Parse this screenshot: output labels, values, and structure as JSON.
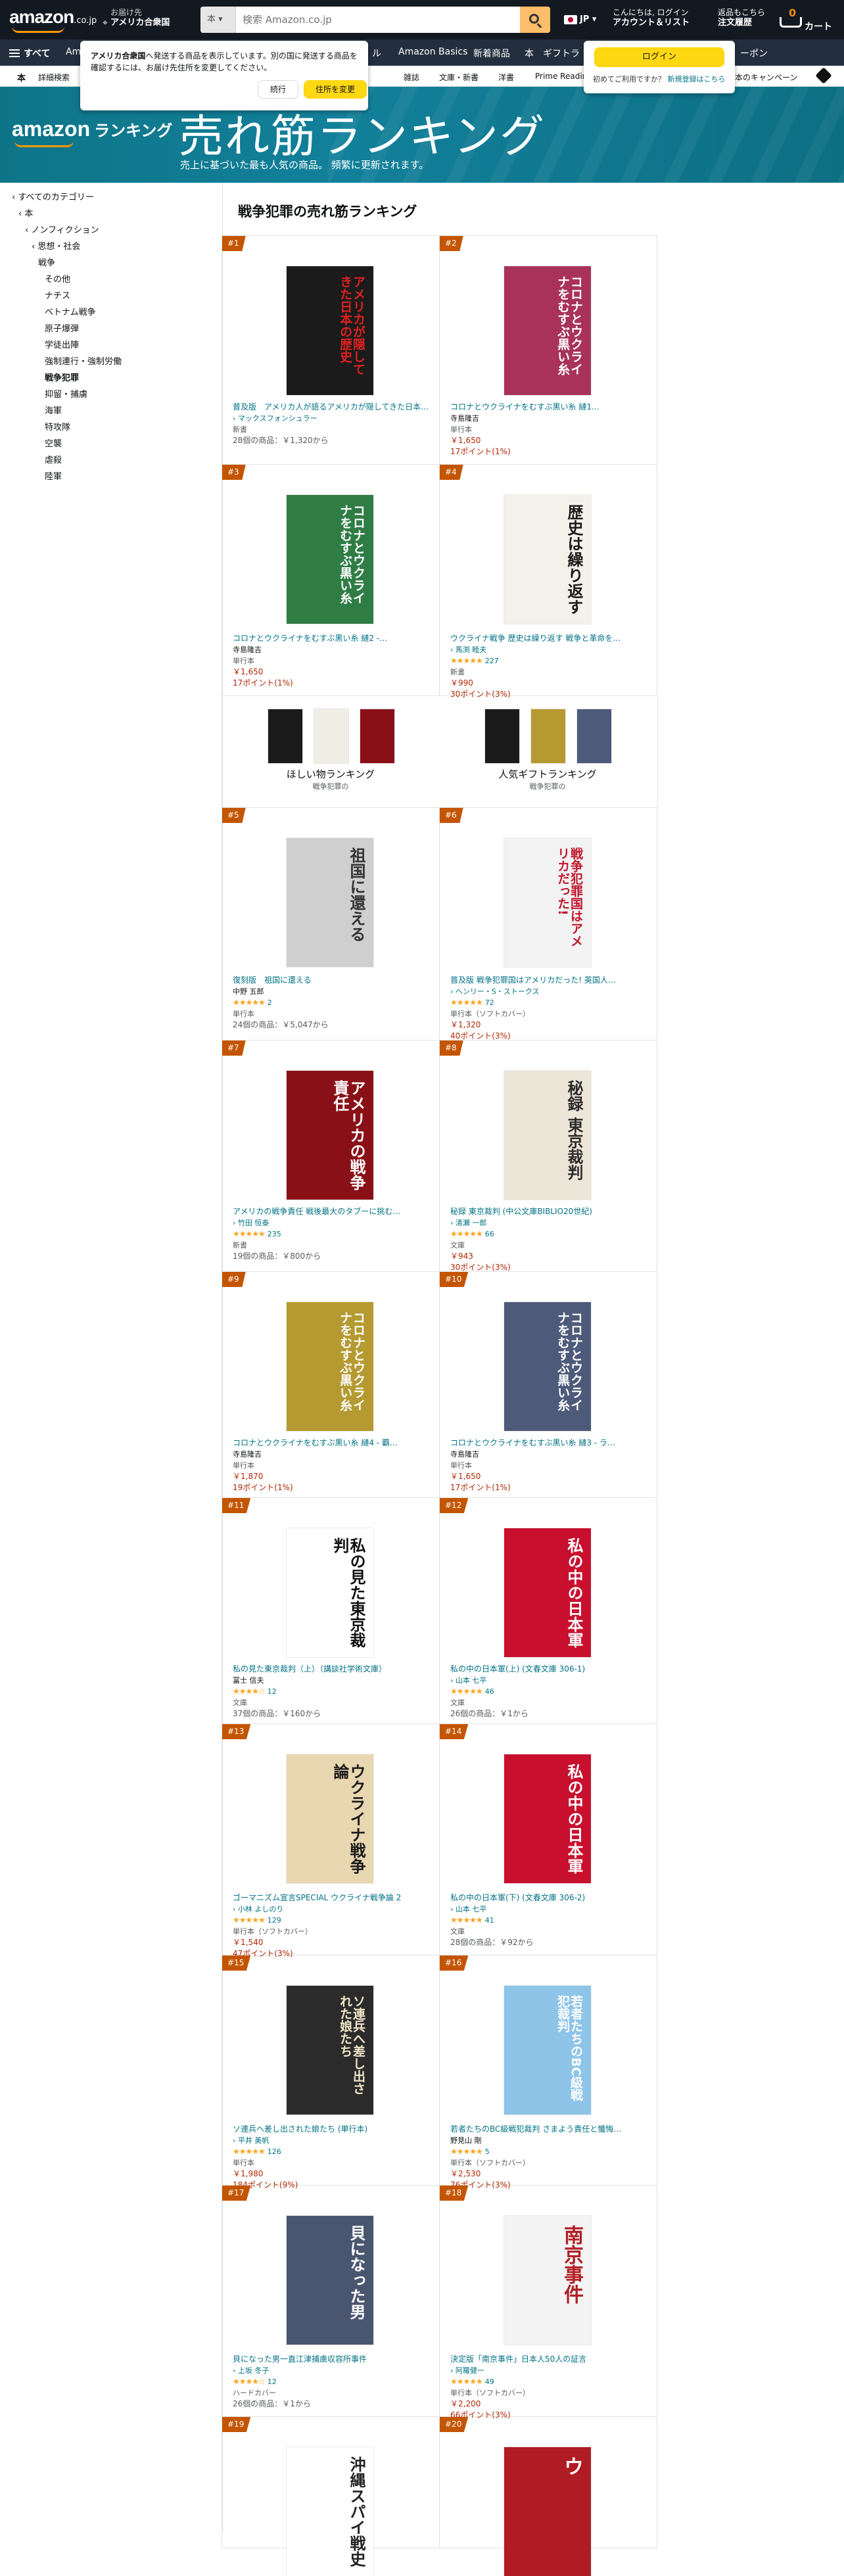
{
  "header": {
    "logo": "amazon",
    "logo_suffix": ".co.jp",
    "deliver_line1": "お届け先",
    "deliver_line2": "アメリカ合衆国",
    "search_category": "本",
    "search_placeholder": "検索 Amazon.co.jp",
    "lang": "JP",
    "account_line1": "こんにちは, ログイン",
    "account_line2": "アカウント＆リスト",
    "orders_line1": "返品もこちら",
    "orders_line2": "注文履歴",
    "cart_count": "0",
    "cart_label": "カート"
  },
  "nav_main": {
    "all": "すべて",
    "links": [
      "Am",
      "ル",
      "Amazon Basics",
      "新着商品",
      "本",
      "ギフトラ",
      "ーポン"
    ]
  },
  "nav_sub": {
    "links": [
      "本",
      "詳細検索",
      "雑誌",
      "文庫・新書",
      "洋書",
      "Prime Readin",
      "本のキャンペーン"
    ]
  },
  "address_popover": {
    "text_bold": "アメリカ合衆国",
    "text": "へ発送する商品を表示しています。別の国に発送する商品を確認するには、お届け先住所を変更してください。",
    "continue": "続行",
    "change": "住所を変更"
  },
  "login_popover": {
    "button": "ログイン",
    "new_customer": "初めてご利用ですか？",
    "register": "新規登録はこちら"
  },
  "banner": {
    "logo": "amazon",
    "logo_suffix": "ランキング",
    "title": "売れ筋ランキング",
    "subtitle": "売上に基づいた最も人気の商品。 頻繁に更新されます。"
  },
  "sidebar": {
    "items": [
      {
        "label": "‹ すべてのカテゴリー",
        "indent": 0
      },
      {
        "label": "‹ 本",
        "indent": 1
      },
      {
        "label": "‹ ノンフィクション",
        "indent": 2
      },
      {
        "label": "‹ 思想・社会",
        "indent": 3
      },
      {
        "label": "戦争",
        "indent": 4
      },
      {
        "label": "その他",
        "indent": 5
      },
      {
        "label": "ナチス",
        "indent": 5
      },
      {
        "label": "ベトナム戦争",
        "indent": 5
      },
      {
        "label": "原子爆弾",
        "indent": 5
      },
      {
        "label": "学徒出陣",
        "indent": 5
      },
      {
        "label": "強制連行・強制労働",
        "indent": 5
      },
      {
        "label": "戦争犯罪",
        "indent": 5,
        "current": true
      },
      {
        "label": "抑留・捕虜",
        "indent": 5
      },
      {
        "label": "海軍",
        "indent": 5
      },
      {
        "label": "特攻隊",
        "indent": 5
      },
      {
        "label": "空襲",
        "indent": 5
      },
      {
        "label": "虐殺",
        "indent": 5
      },
      {
        "label": "陸軍",
        "indent": 5
      }
    ]
  },
  "heading": "戦争犯罪の売れ筋ランキング",
  "promo": {
    "left_title": "ほしい物ランキング",
    "left_sub": "戦争犯罪の",
    "right_title": "人気ギフトランキング",
    "right_sub": "戦争犯罪の"
  },
  "products": [
    {
      "rank": "#1",
      "title": "普及版　アメリカ人が語るアメリカが隠してきた日本の歴史",
      "author": "マックスフォンシュラー",
      "author_link": true,
      "format": "新書",
      "offers": "28個の商品：￥1,320から",
      "cover_text": "アメリカが隠してきた日本の歴史",
      "cover_bg": "#1b1b1b",
      "cover_fg": "#e02020"
    },
    {
      "rank": "#2",
      "title": "コロナとウクライナをむすぶ黒い糸 縺1…",
      "author": "寺島隆吉",
      "format": "単行本",
      "price": "￥1,650",
      "points": "17ポイント(1%)",
      "cover_text": "コロナとウクライナをむすぶ黒い糸",
      "cover_bg": "#a8325a",
      "cover_fg": "#ffffff"
    },
    {
      "rank": "#3",
      "title": "コロナとウクライナをむすぶ黒い糸 縺2 ‐…",
      "author": "寺島隆吉",
      "format": "単行本",
      "price": "￥1,650",
      "points": "17ポイント(1%)",
      "cover_text": "コロナとウクライナをむすぶ黒い糸",
      "cover_bg": "#2f7d45",
      "cover_fg": "#ffffff"
    },
    {
      "rank": "#4",
      "title": "ウクライナ戦争 歴史は繰り返す 戦争と革命を…",
      "author": "馬渕 睦夫",
      "author_link": true,
      "stars": "★★★★★",
      "reviews": "227",
      "format": "新書",
      "price": "￥990",
      "points": "30ポイント(3%)",
      "cover_text": "歴史は繰り返す",
      "cover_bg": "#f4f1ea",
      "cover_fg": "#1a1a1a"
    },
    {
      "rank": "#5",
      "title": "復刻版　祖国に還える",
      "author": "中野 五郎",
      "stars": "★★★★★",
      "reviews": "2",
      "format": "単行本",
      "offers": "24個の商品：￥5,047から",
      "cover_text": "祖国に還える",
      "cover_bg": "#cfcfcf",
      "cover_fg": "#333333"
    },
    {
      "rank": "#6",
      "title": "普及版 戦争犯罪国はアメリカだった! 英国人…",
      "author": "ヘンリー・S・ストークス",
      "author_link": true,
      "stars": "★★★★★",
      "reviews": "72",
      "format": "単行本（ソフトカバー）",
      "price": "￥1,320",
      "points": "40ポイント(3%)",
      "cover_text": "戦争犯罪国はアメリカだった!",
      "cover_bg": "#f3f3f3",
      "cover_fg": "#c0162c"
    },
    {
      "rank": "#7",
      "title": "アメリカの戦争責任 戦後最大のタブーに挑む…",
      "author": "竹田 恒泰",
      "author_link": true,
      "stars": "★★★★★",
      "reviews": "235",
      "format": "新書",
      "offers": "19個の商品：￥800から",
      "cover_text": "アメリカの戦争責任",
      "cover_bg": "#8a1018",
      "cover_fg": "#ffffff"
    },
    {
      "rank": "#8",
      "title": "秘録 東京裁判 (中公文庫BIBLIO20世紀)",
      "author": "清瀬 一郎",
      "author_link": true,
      "stars": "★★★★★",
      "reviews": "66",
      "format": "文庫",
      "price": "￥943",
      "points": "30ポイント(3%)",
      "cover_text": "秘録 東京裁判",
      "cover_bg": "#ece6d8",
      "cover_fg": "#2b2b2b"
    },
    {
      "rank": "#9",
      "title": "コロナとウクライナをむすぶ黒い糸 縺4 ‐ 覇…",
      "author": "寺島隆吉",
      "format": "単行本",
      "price": "￥1,870",
      "points": "19ポイント(1%)",
      "cover_text": "コロナとウクライナをむすぶ黒い糸",
      "cover_bg": "#b59a32",
      "cover_fg": "#ffffff"
    },
    {
      "rank": "#10",
      "title": "コロナとウクライナをむすぶ黒い糸 縺3 ‐ ラ…",
      "author": "寺島隆吉",
      "format": "単行本",
      "price": "￥1,650",
      "points": "17ポイント(1%)",
      "cover_text": "コロナとウクライナをむすぶ黒い糸",
      "cover_bg": "#4d5a7a",
      "cover_fg": "#ffffff"
    },
    {
      "rank": "#11",
      "title": "私の見た東京裁判（上）（講談社学術文庫）",
      "author": "冨士 信夫",
      "stars": "★★★★☆",
      "reviews": "12",
      "format": "文庫",
      "offers": "37個の商品：￥160から",
      "cover_text": "私の見た東京裁判",
      "cover_bg": "#ffffff",
      "cover_fg": "#111111"
    },
    {
      "rank": "#12",
      "title": "私の中の日本軍(上) (文春文庫 306-1)",
      "author": "山本 七平",
      "author_link": true,
      "stars": "★★★★★",
      "reviews": "46",
      "format": "文庫",
      "offers": "26個の商品：￥1から",
      "cover_text": "私の中の日本軍",
      "cover_bg": "#c8102e",
      "cover_fg": "#ffffff"
    },
    {
      "rank": "#13",
      "title": "ゴーマニズム宣言SPECIAL ウクライナ戦争論 2",
      "author": "小林 よしのり",
      "author_link": true,
      "stars": "★★★★★",
      "reviews": "129",
      "format": "単行本（ソフトカバー）",
      "price": "￥1,540",
      "points": "47ポイント(3%)",
      "cover_text": "ウクライナ戦争論",
      "cover_bg": "#e8d7b0",
      "cover_fg": "#1a1a1a"
    },
    {
      "rank": "#14",
      "title": "私の中の日本軍(下) (文春文庫 306-2)",
      "author": "山本 七平",
      "author_link": true,
      "stars": "★★★★★",
      "reviews": "41",
      "format": "文庫",
      "offers": "28個の商品：￥92から",
      "cover_text": "私の中の日本軍",
      "cover_bg": "#c8102e",
      "cover_fg": "#ffffff"
    },
    {
      "rank": "#15",
      "title": "ソ連兵へ差し出された娘たち (単行本)",
      "author": "平井 美帆",
      "author_link": true,
      "stars": "★★★★★",
      "reviews": "126",
      "format": "単行本",
      "price": "￥1,980",
      "points": "184ポイント(9%)",
      "cover_text": "ソ連兵へ差し出された娘たち",
      "cover_bg": "#2b2b2b",
      "cover_fg": "#f0e6c8"
    },
    {
      "rank": "#16",
      "title": "若者たちのBC級戦犯裁判 さまよう責任と懺悔…",
      "author": "野見山 剛",
      "stars": "★★★★★",
      "reviews": "5",
      "format": "単行本（ソフトカバー）",
      "price": "￥2,530",
      "points": "76ポイント(3%)",
      "cover_text": "若者たちのBC級戦犯裁判",
      "cover_bg": "#8dc4e8",
      "cover_fg": "#ffffff"
    },
    {
      "rank": "#17",
      "title": "貝になった男一直江津捕虜収容所事件",
      "author": "上坂 冬子",
      "author_link": true,
      "stars": "★★★★☆",
      "reviews": "12",
      "format": "ハードカバー",
      "offers": "26個の商品：￥1から",
      "cover_text": "貝になった男",
      "cover_bg": "#4a5570",
      "cover_fg": "#ffffff"
    },
    {
      "rank": "#18",
      "title": "決定版「南京事件」日本人50人の証言",
      "author": "阿羅健一",
      "author_link": true,
      "stars": "★★★★★",
      "reviews": "49",
      "format": "単行本（ソフトカバー）",
      "price": "￥2,200",
      "points": "66ポイント(3%)",
      "cover_text": "南京事件",
      "cover_bg": "#f4f4f4",
      "cover_fg": "#b11f24"
    },
    {
      "rank": "#19",
      "title": "",
      "format": "",
      "cover_text": "沖縄スパイ戦史",
      "cover_bg": "#ffffff",
      "cover_fg": "#222222"
    },
    {
      "rank": "#20",
      "title": "",
      "format": "",
      "cover_text": "ウ",
      "cover_bg": "#b01c24",
      "cover_fg": "#ffffff"
    }
  ]
}
